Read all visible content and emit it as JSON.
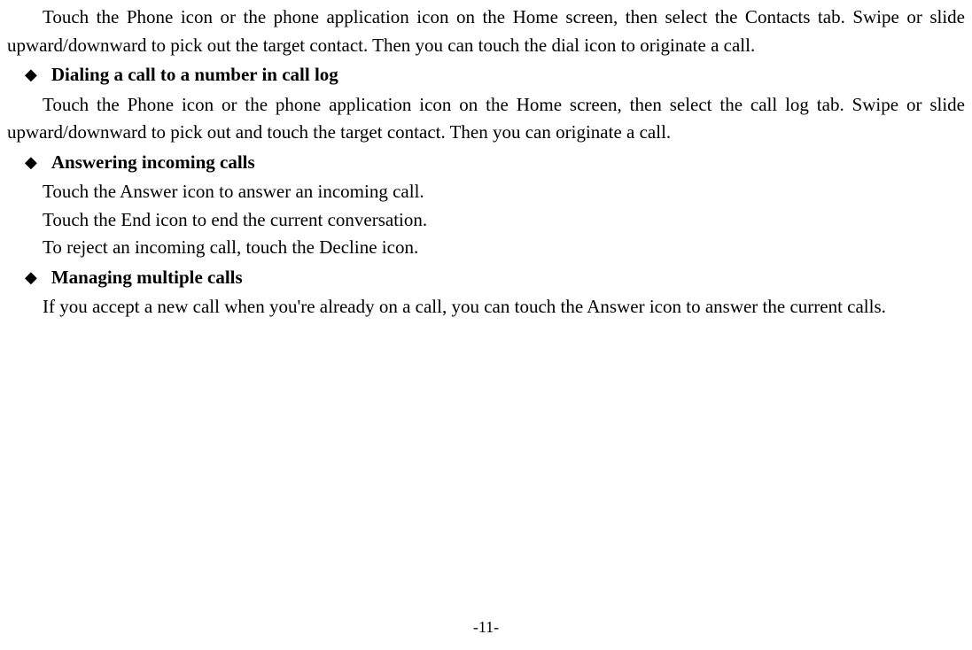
{
  "paragraphs": {
    "p1": "Touch the Phone icon or the phone application icon on the Home screen, then select the Contacts tab. Swipe or slide upward/downward to pick out the target contact. Then you can touch the dial icon to originate a call.",
    "h1": "Dialing a call to a number in call log",
    "p2": "Touch the Phone icon or the phone application icon on the Home screen, then select the call log tab. Swipe or slide upward/downward to pick out and touch the target contact. Then you can originate a call.",
    "h2": "Answering incoming calls",
    "p3": "Touch the Answer icon to answer an incoming call.",
    "p4": "Touch the End icon to end the current conversation.",
    "p5": "To reject an incoming call, touch the Decline icon.",
    "h3": "Managing multiple calls",
    "p6": "If you accept a new call when you're already on a call, you can touch the Answer icon to answer the current calls."
  },
  "bullet": "◆",
  "pageNumber": "-11-"
}
